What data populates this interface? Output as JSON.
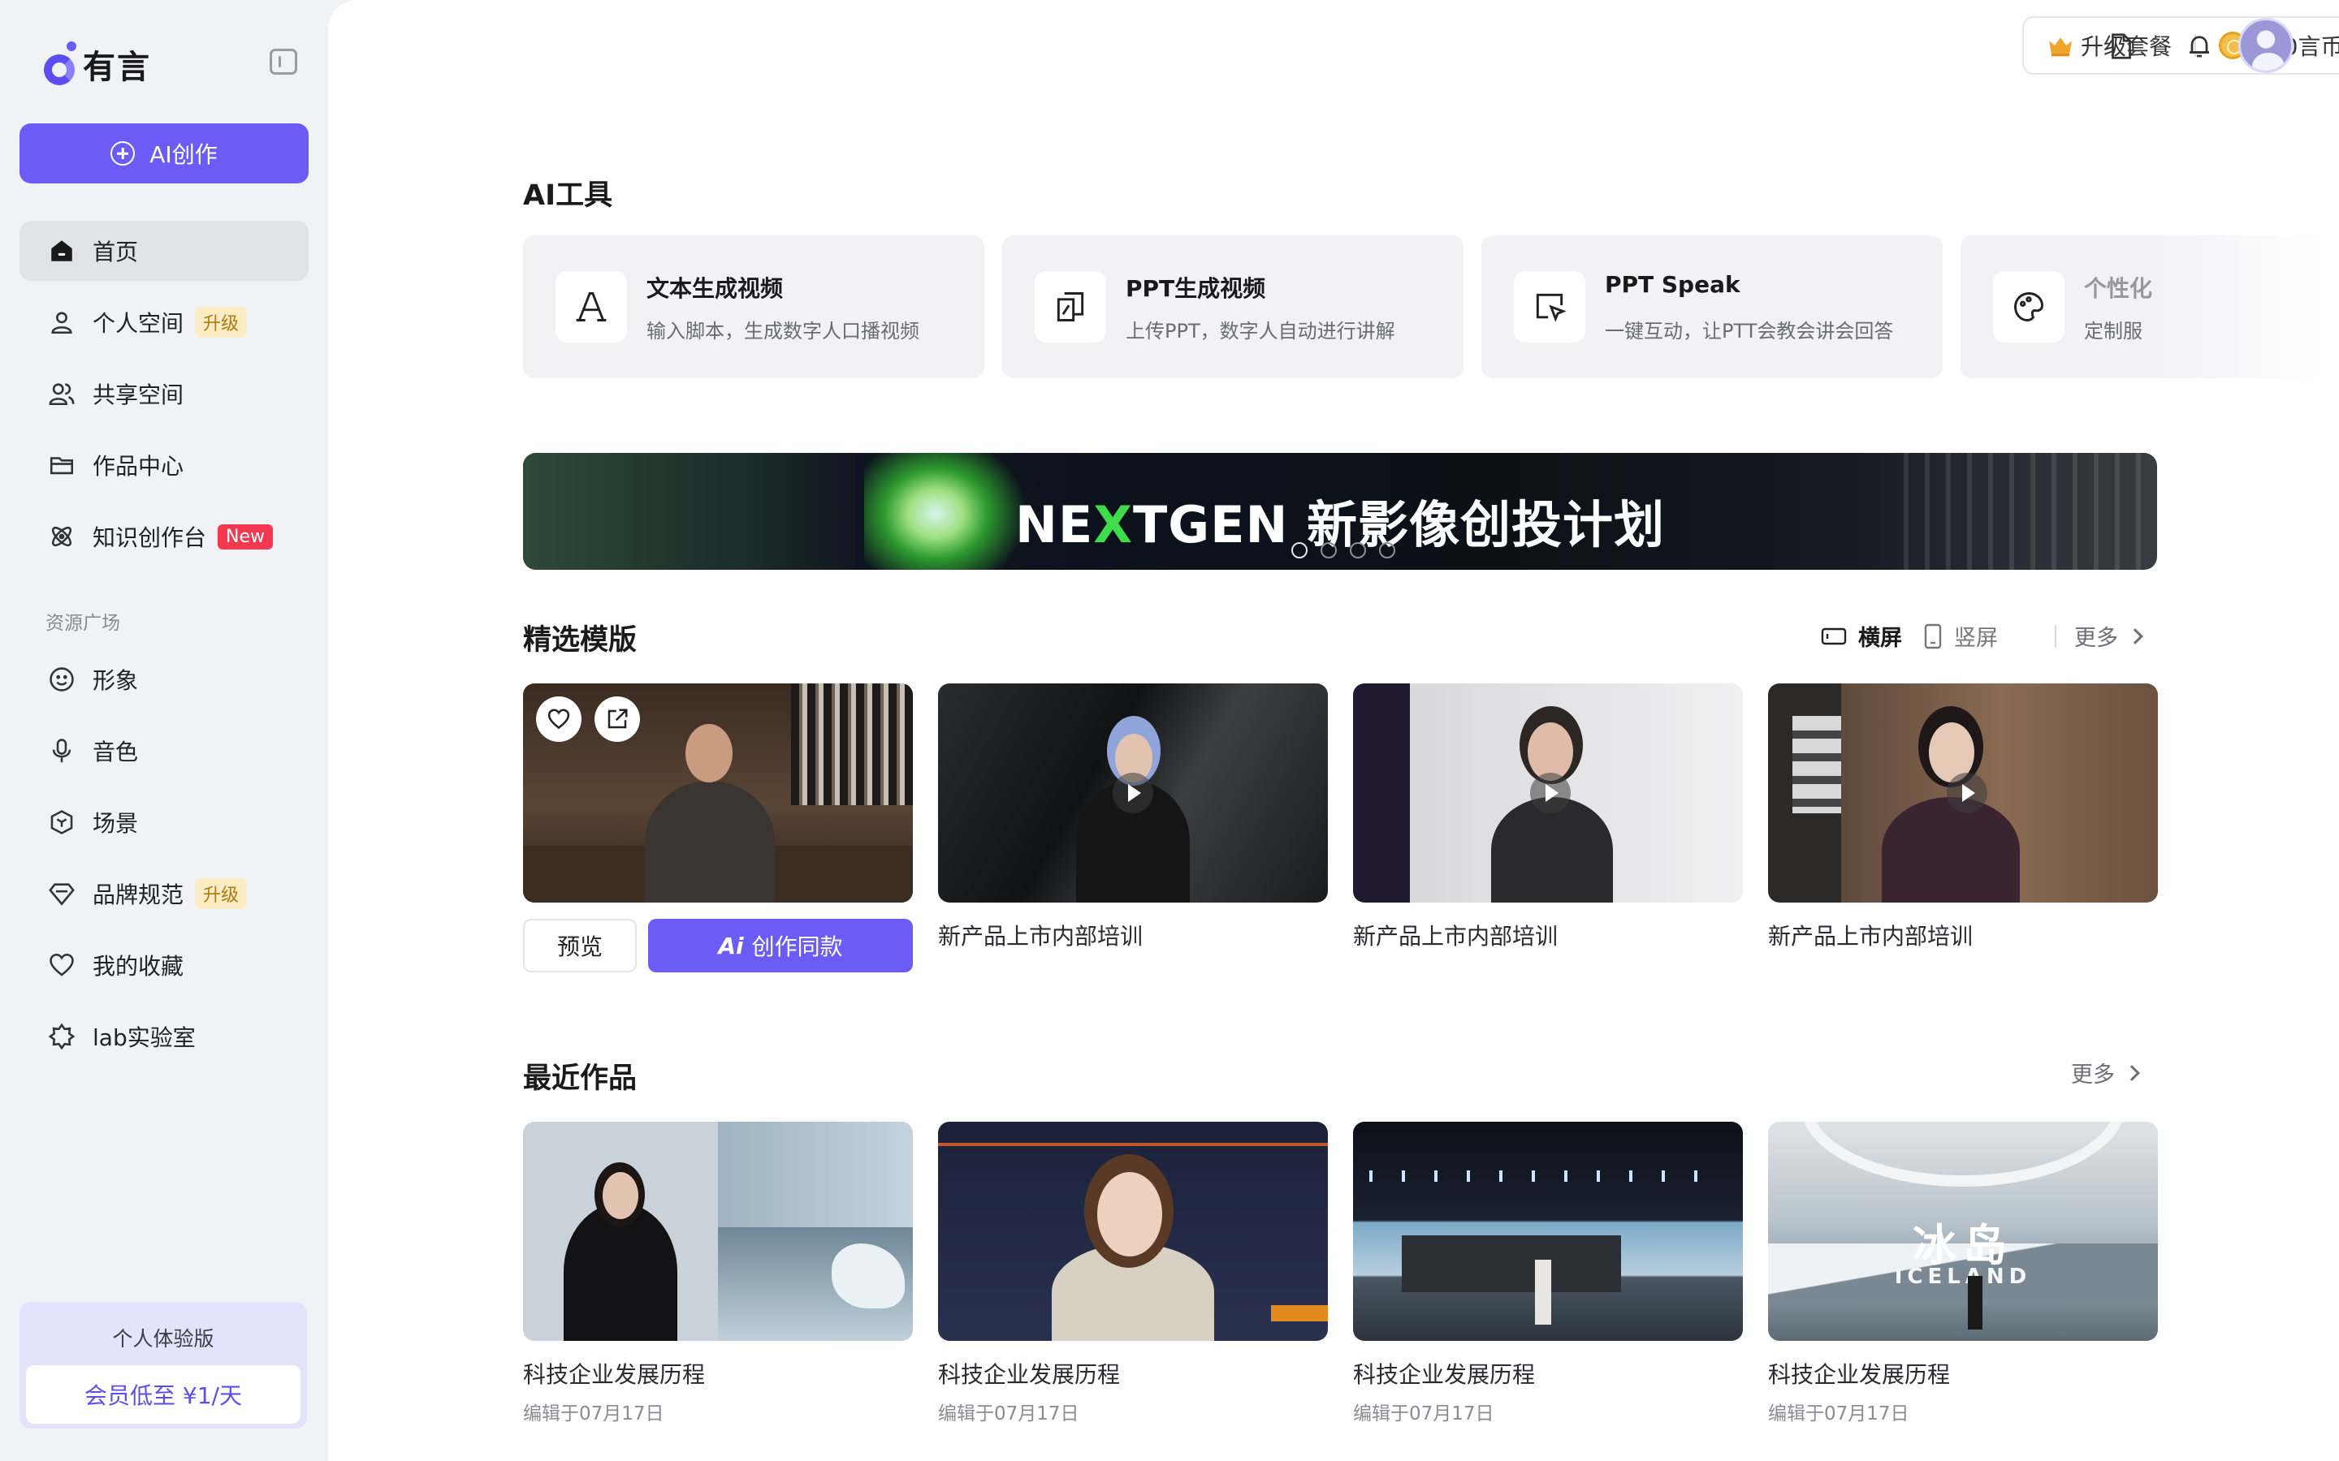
{
  "app": {
    "brand": "有言"
  },
  "sidebar": {
    "create_label": "AI创作",
    "items": [
      {
        "label": "首页",
        "icon": "home-icon",
        "active": true
      },
      {
        "label": "个人空间",
        "icon": "user-icon",
        "badge": "升级"
      },
      {
        "label": "共享空间",
        "icon": "users-icon"
      },
      {
        "label": "作品中心",
        "icon": "folder-icon"
      },
      {
        "label": "知识创作台",
        "icon": "atom-icon",
        "badge": "New"
      }
    ],
    "section_label": "资源广场",
    "resources": [
      {
        "label": "形象",
        "icon": "smile-icon"
      },
      {
        "label": "音色",
        "icon": "microphone-icon"
      },
      {
        "label": "场景",
        "icon": "cube-icon"
      },
      {
        "label": "品牌规范",
        "icon": "diamond-icon",
        "badge": "升级"
      },
      {
        "label": "我的收藏",
        "icon": "heart-icon"
      },
      {
        "label": "lab实验室",
        "icon": "lab-icon"
      }
    ],
    "trial": {
      "title": "个人体验版",
      "cta": "会员低至 ¥1/天"
    }
  },
  "topbar": {
    "upgrade_label": "升级套餐",
    "coins_label": "300言币",
    "icons": [
      "crown-icon",
      "coin-icon",
      "document-icon",
      "bell-icon",
      "avatar"
    ]
  },
  "ai_tools": {
    "title": "AI工具",
    "cards": [
      {
        "name": "文本生成视频",
        "desc": "输入脚本，生成数字人口播视频",
        "icon": "text-a-icon"
      },
      {
        "name": "PPT生成视频",
        "desc": "上传PPT，数字人自动进行讲解",
        "icon": "ppt-icon"
      },
      {
        "name": "PPT Speak",
        "desc": "一键互动，让PTT会教会讲会回答",
        "icon": "cursor-board-icon"
      },
      {
        "name": "个性化",
        "desc": "定制服",
        "icon": "palette-icon"
      }
    ]
  },
  "banner": {
    "brand_pre": "NE",
    "brand_x": "X",
    "brand_post": "TGEN",
    "title": "新影像创投计划",
    "slides": 4,
    "active_slide": 1
  },
  "templates": {
    "title": "精选模版",
    "view_landscape": "横屏",
    "view_portrait": "竖屏",
    "more": "更多",
    "preview_btn": "预览",
    "create_same_btn": "创作同款",
    "create_same_prefix": "Ai",
    "items": [
      {
        "caption": ""
      },
      {
        "caption": "新产品上市内部培训"
      },
      {
        "caption": "新产品上市内部培训"
      },
      {
        "caption": "新产品上市内部培训"
      }
    ]
  },
  "recent": {
    "title": "最近作品",
    "more": "更多",
    "items": [
      {
        "caption": "科技企业发展历程",
        "date": "编辑于07月17日"
      },
      {
        "caption": "科技企业发展历程",
        "date": "编辑于07月17日"
      },
      {
        "caption": "科技企业发展历程",
        "date": "编辑于07月17日"
      },
      {
        "caption": "科技企业发展历程",
        "date": "编辑于07月17日",
        "overlay_cn": "冰岛",
        "overlay_en": "ICELAND"
      }
    ]
  },
  "colors": {
    "accent": "#6b5cf5",
    "badge_new": "#f4384f",
    "badge_up_bg": "#fbecc4"
  }
}
